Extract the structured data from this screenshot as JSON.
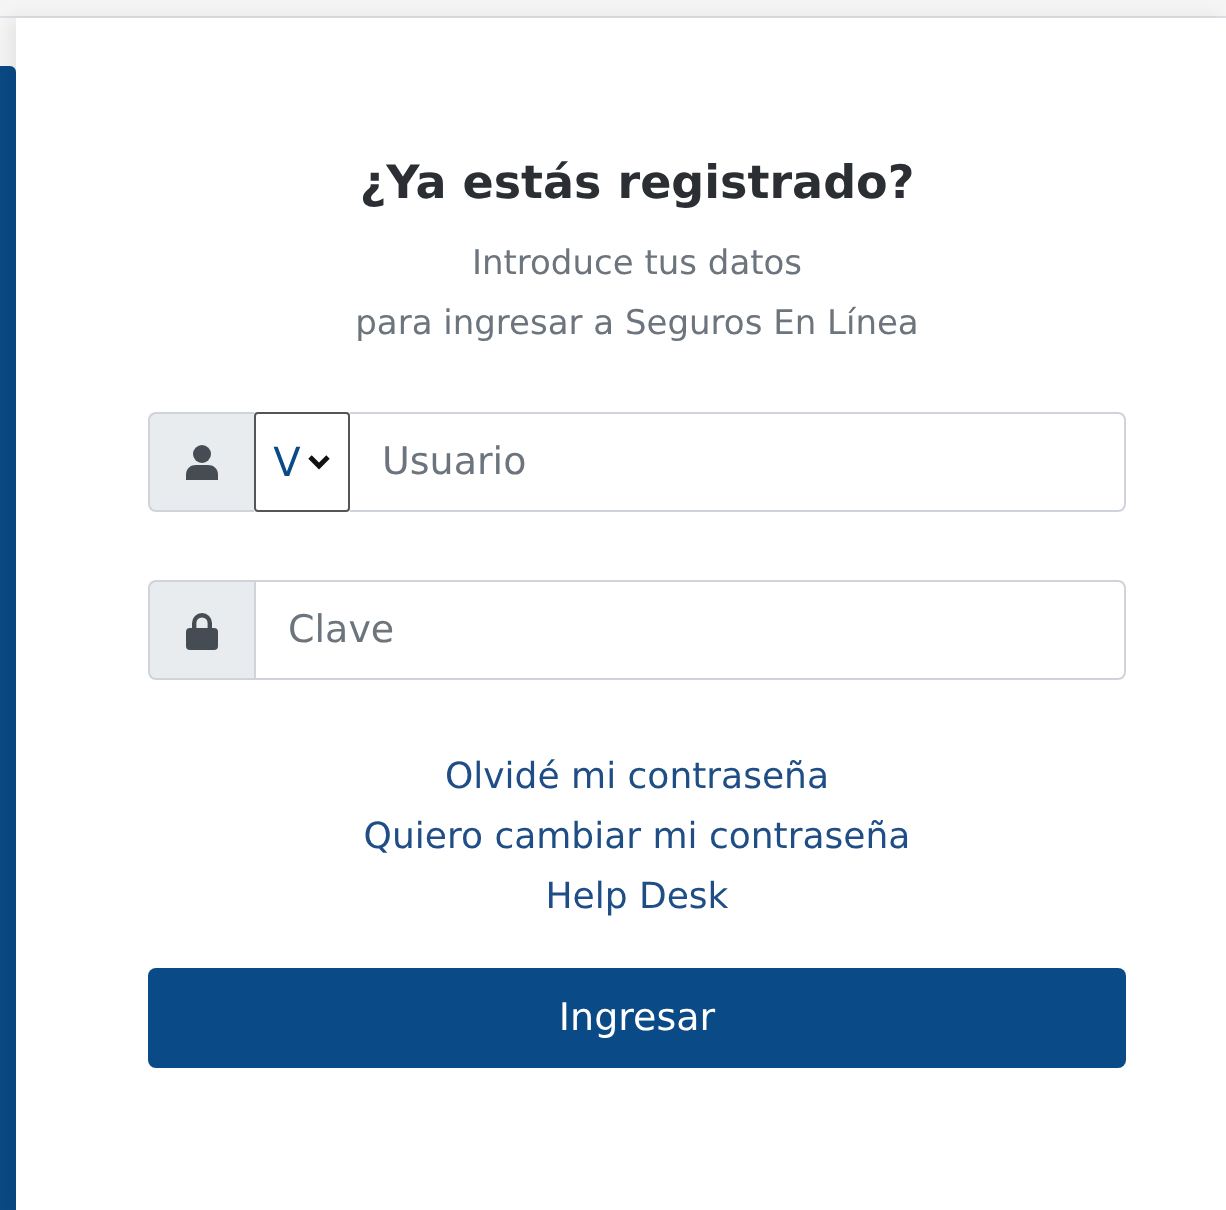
{
  "heading": "¿Ya estás registrado?",
  "subtitle_lines": [
    "Introduce tus datos",
    "para ingresar a Seguros En Línea"
  ],
  "fields": [
    {
      "kind": "user",
      "select": "V",
      "placeholder": "Usuario"
    },
    {
      "kind": "password",
      "placeholder": "Clave"
    }
  ],
  "links": [
    "Olvidé mi contraseña",
    "Quiero cambiar mi contraseña",
    "Help Desk"
  ],
  "submit_button": "Ingresar"
}
